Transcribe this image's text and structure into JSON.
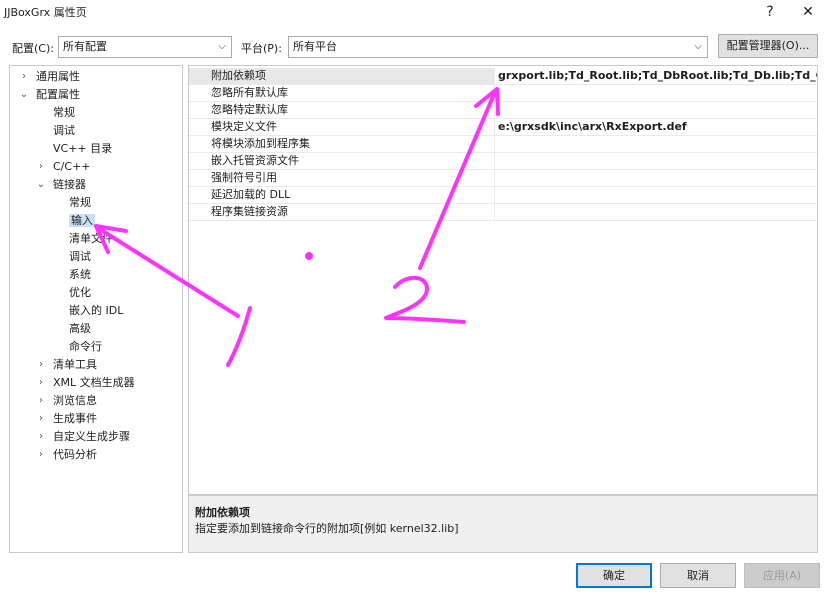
{
  "window": {
    "title": "JJBoxGrx 属性页",
    "help_glyph": "?",
    "close_glyph": "✕"
  },
  "toolbar": {
    "config_label": "配置(C):",
    "config_value": "所有配置",
    "platform_label": "平台(P):",
    "platform_value": "所有平台",
    "config_manager_label": "配置管理器(O)..."
  },
  "tree": {
    "items": [
      {
        "label": "通用属性",
        "arrow": "›"
      },
      {
        "label": "配置属性",
        "arrow": "⌄"
      },
      {
        "label": "常规",
        "arrow": ""
      },
      {
        "label": "调试",
        "arrow": ""
      },
      {
        "label": "VC++ 目录",
        "arrow": ""
      },
      {
        "label": "C/C++",
        "arrow": "›"
      },
      {
        "label": "链接器",
        "arrow": "⌄"
      },
      {
        "label": "常规",
        "arrow": ""
      },
      {
        "label": "输入",
        "arrow": ""
      },
      {
        "label": "清单文件",
        "arrow": ""
      },
      {
        "label": "调试",
        "arrow": ""
      },
      {
        "label": "系统",
        "arrow": ""
      },
      {
        "label": "优化",
        "arrow": ""
      },
      {
        "label": "嵌入的 IDL",
        "arrow": ""
      },
      {
        "label": "高级",
        "arrow": ""
      },
      {
        "label": "命令行",
        "arrow": ""
      },
      {
        "label": "清单工具",
        "arrow": "›"
      },
      {
        "label": "XML 文档生成器",
        "arrow": "›"
      },
      {
        "label": "浏览信息",
        "arrow": "›"
      },
      {
        "label": "生成事件",
        "arrow": "›"
      },
      {
        "label": "自定义生成步骤",
        "arrow": "›"
      },
      {
        "label": "代码分析",
        "arrow": "›"
      }
    ]
  },
  "grid": {
    "rows": [
      {
        "name": "附加依赖项",
        "value": "grxport.lib;Td_Root.lib;Td_DbRoot.lib;Td_Db.lib;Td_Ge.lib;T"
      },
      {
        "name": "忽略所有默认库",
        "value": ""
      },
      {
        "name": "忽略特定默认库",
        "value": ""
      },
      {
        "name": "模块定义文件",
        "value": "e:\\grxsdk\\inc\\arx\\RxExport.def"
      },
      {
        "name": "将模块添加到程序集",
        "value": ""
      },
      {
        "name": "嵌入托管资源文件",
        "value": ""
      },
      {
        "name": "强制符号引用",
        "value": ""
      },
      {
        "name": "延迟加载的 DLL",
        "value": ""
      },
      {
        "name": "程序集链接资源",
        "value": ""
      }
    ]
  },
  "description": {
    "title": "附加依赖项",
    "text": "指定要添加到链接命令行的附加项[例如 kernel32.lib]"
  },
  "buttons": {
    "ok": "确定",
    "cancel": "取消",
    "apply": "应用(A)"
  },
  "annotations": {
    "color": "#ff33ff"
  }
}
